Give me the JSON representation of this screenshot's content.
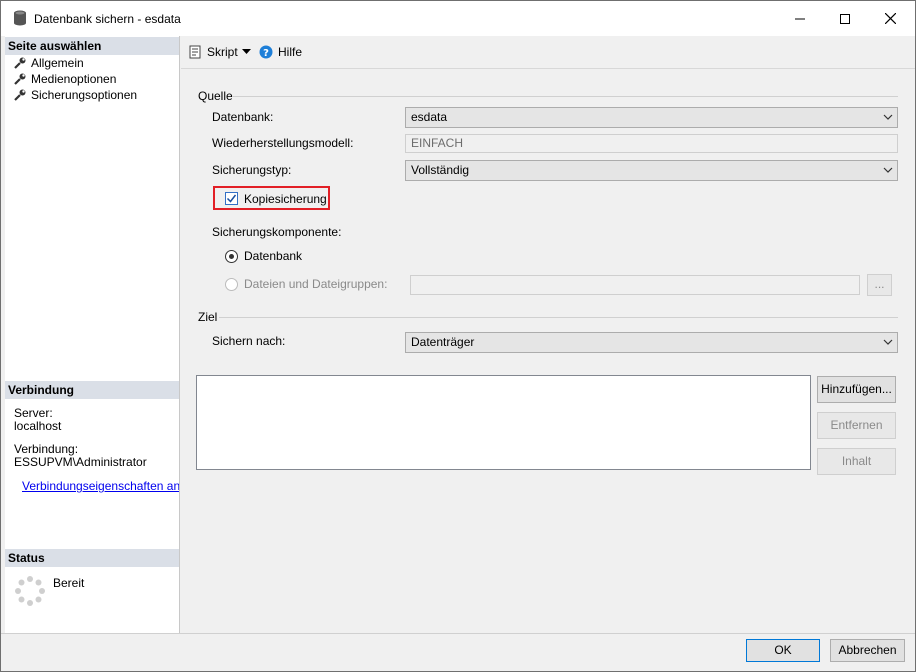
{
  "window": {
    "title": "Datenbank sichern - esdata",
    "controls": {
      "minimize": "minimize",
      "maximize": "maximize",
      "close": "close"
    }
  },
  "left_pane": {
    "select_page_header": "Seite auswählen",
    "pages": [
      {
        "label": "Allgemein",
        "icon": "wrench-icon",
        "selected": true
      },
      {
        "label": "Medienoptionen",
        "icon": "wrench-icon",
        "selected": false
      },
      {
        "label": "Sicherungsoptionen",
        "icon": "wrench-icon",
        "selected": false
      }
    ],
    "connection_header": "Verbindung",
    "server_label": "Server:",
    "server_value": "localhost",
    "connection_label": "Verbindung:",
    "connection_value": "ESSUPVM\\Administrator",
    "connection_properties_link": "Verbindungseigenschaften anzeigen",
    "status_header": "Status",
    "status_value": "Bereit"
  },
  "toolbar": {
    "script_label": "Skript",
    "help_label": "Hilfe"
  },
  "source": {
    "group_label": "Quelle",
    "database_label": "Datenbank:",
    "database_value": "esdata",
    "recovery_model_label": "Wiederherstellungsmodell:",
    "recovery_model_value": "EINFACH",
    "backup_type_label": "Sicherungstyp:",
    "backup_type_value": "Vollständig",
    "copy_only_label": "Kopiesicherung",
    "copy_only_checked": true,
    "backup_component_label": "Sicherungskomponente:",
    "component_database_label": "Datenbank",
    "component_files_label": "Dateien und Dateigruppen:",
    "files_button_label": "..."
  },
  "destination": {
    "group_label": "Ziel",
    "backup_to_label": "Sichern nach:",
    "backup_to_value": "Datenträger",
    "add_button": "Hinzufügen...",
    "remove_button": "Entfernen",
    "contents_button": "Inhalt"
  },
  "footer": {
    "ok_button": "OK",
    "cancel_button": "Abbrechen"
  },
  "colors": {
    "highlight_border": "#e21f26",
    "link": "#0000ee",
    "help_icon": "#1e7fd8"
  }
}
